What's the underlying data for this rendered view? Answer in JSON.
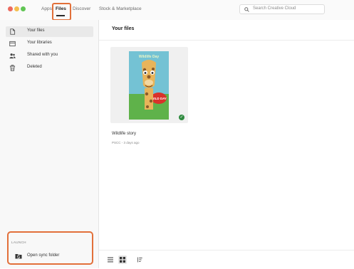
{
  "titlebar": {
    "tabs": [
      {
        "label": "Apps"
      },
      {
        "label": "Files"
      },
      {
        "label": "Discover"
      },
      {
        "label": "Stock & Marketplace"
      }
    ],
    "search_placeholder": "Search Creative Cloud"
  },
  "sidebar": {
    "items": [
      {
        "label": "Your files",
        "icon": "file-icon"
      },
      {
        "label": "Your libraries",
        "icon": "library-icon"
      },
      {
        "label": "Shared with you",
        "icon": "people-icon"
      },
      {
        "label": "Deleted",
        "icon": "trash-icon"
      }
    ],
    "launch_label": "LAUNCH",
    "open_sync_label": "Open sync folder"
  },
  "main": {
    "title": "Your files",
    "file": {
      "name": "Wildlife story",
      "meta": "PSCC - 3 days ago",
      "cover_title": "Wildlife Day",
      "cover_sub": "WILD DAY"
    }
  },
  "colors": {
    "highlight": "#e2703a",
    "sync_check": "#2f8a3f"
  }
}
